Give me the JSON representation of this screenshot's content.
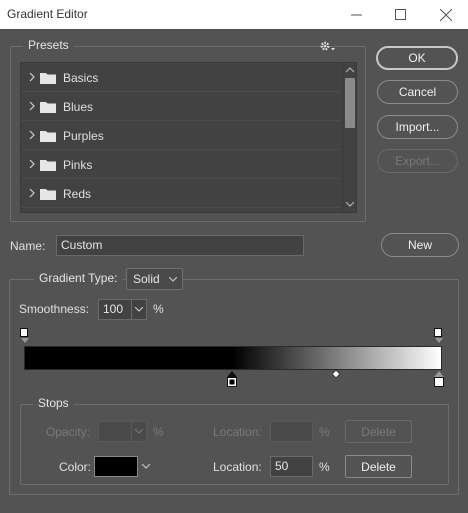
{
  "window": {
    "title": "Gradient Editor",
    "minimize_icon": "minimize-icon",
    "maximize_icon": "maximize-icon",
    "close_icon": "close-icon"
  },
  "presets": {
    "label": "Presets",
    "items": [
      {
        "label": "Basics"
      },
      {
        "label": "Blues"
      },
      {
        "label": "Purples"
      },
      {
        "label": "Pinks"
      },
      {
        "label": "Reds"
      }
    ]
  },
  "buttons": {
    "ok": "OK",
    "cancel": "Cancel",
    "import": "Import...",
    "export": "Export...",
    "new": "New"
  },
  "name_field": {
    "label": "Name:",
    "value": "Custom"
  },
  "gradient_type": {
    "label": "Gradient Type:",
    "value": "Solid"
  },
  "smoothness": {
    "label": "Smoothness:",
    "value": "100",
    "unit": "%"
  },
  "gradient": {
    "start_color": "#000000",
    "end_color": "#ffffff",
    "midpoint_percent": 50
  },
  "stops": {
    "label": "Stops",
    "opacity_label": "Opacity:",
    "opacity_unit": "%",
    "opacity_location_label": "Location:",
    "opacity_location_unit": "%",
    "opacity_delete": "Delete",
    "color_label": "Color:",
    "color_value": "#000000",
    "color_location_label": "Location:",
    "color_location_value": "50",
    "color_location_unit": "%",
    "color_delete": "Delete"
  }
}
